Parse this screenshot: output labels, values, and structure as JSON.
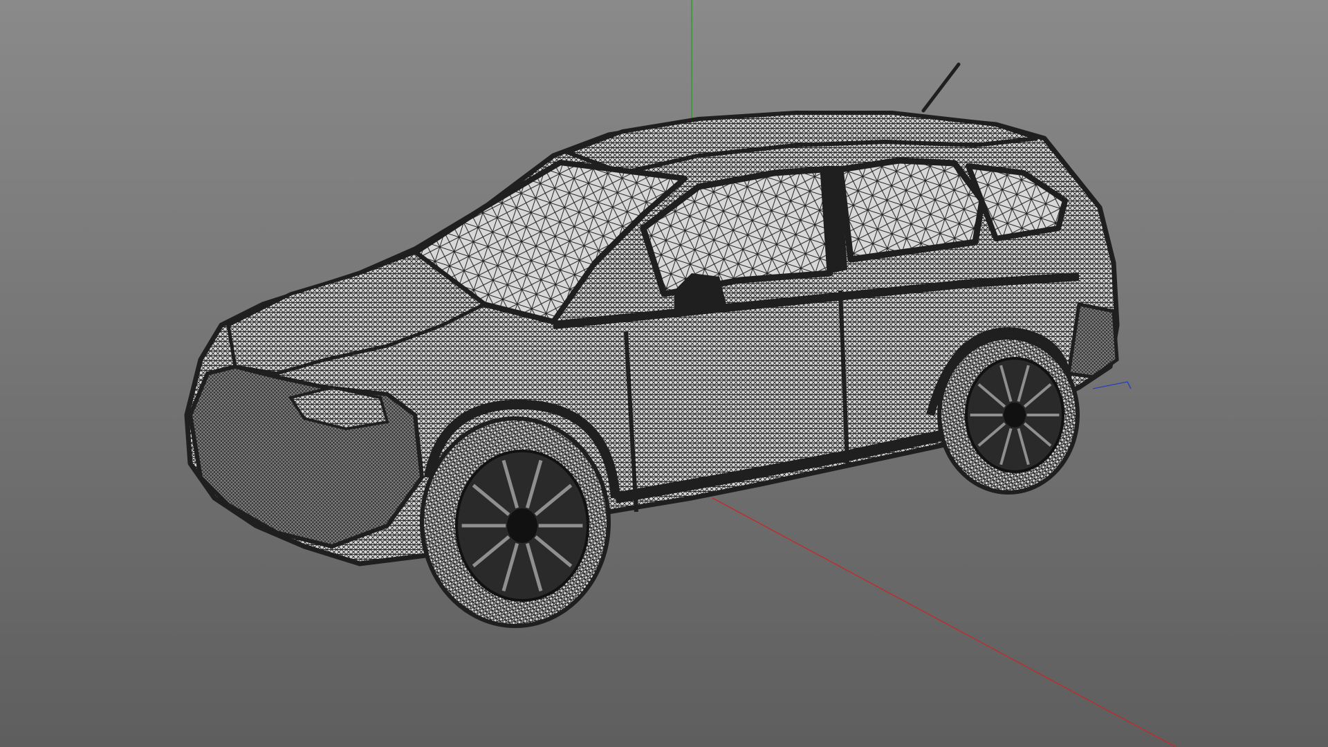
{
  "viewport": {
    "mode": "wireframe",
    "background_top": "#8a8a8a",
    "background_bottom": "#5e5e5e",
    "wire_color": "#222222",
    "surface_color": "#d8d8d8",
    "icons": [
      "model-wireframe-icon",
      "world-axis-gizmo-icon"
    ]
  },
  "axes": {
    "x_color": "#c62828",
    "y_color": "#2e9d2e",
    "z_color": "#2b3fb8"
  }
}
